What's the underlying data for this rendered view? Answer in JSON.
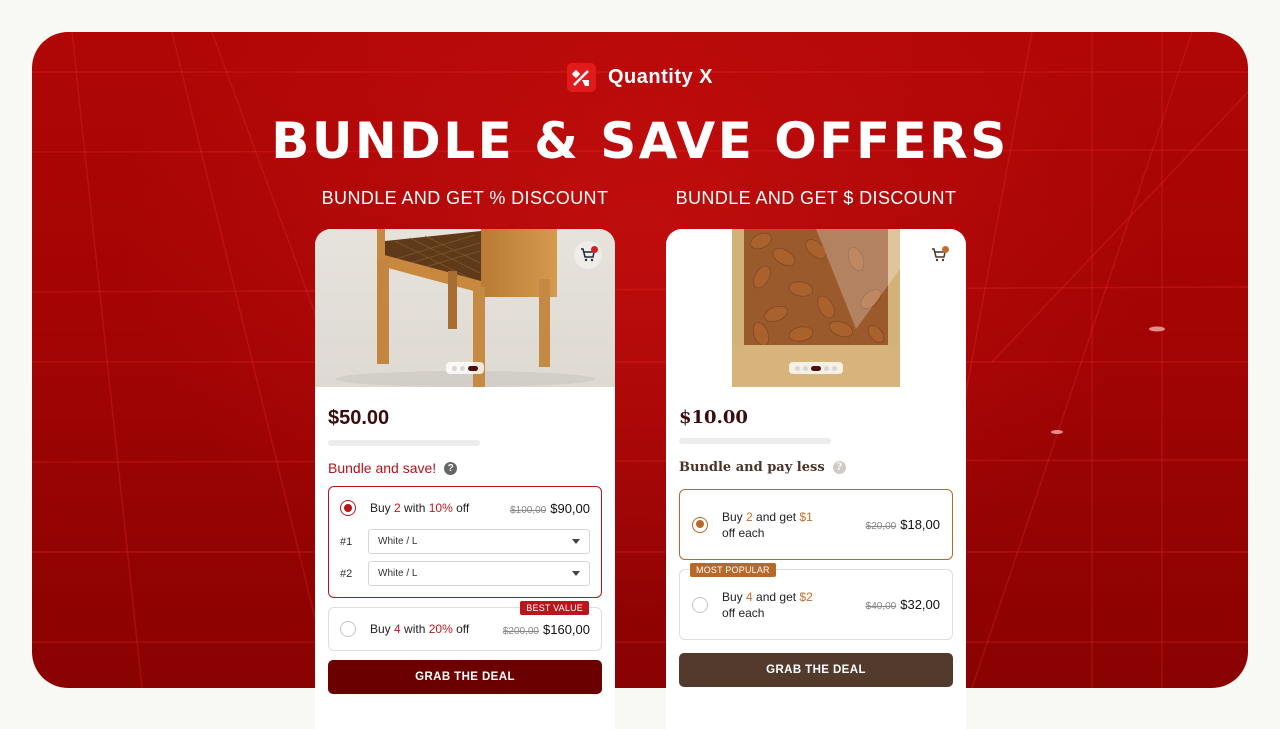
{
  "brand": {
    "name": "Quantity X",
    "logo_icon": "percent-tag-icon",
    "color": "#e11b1b"
  },
  "headline": "BUNDLE & SAVE OFFERS",
  "colors": {
    "banner_red": "#a30404",
    "left_accent": "#b8161c",
    "left_cta": "#6b0000",
    "right_accent": "#b8692a",
    "right_cta": "#523b2d"
  },
  "panels": [
    {
      "subtitle": "BUNDLE AND GET % DISCOUNT",
      "product_image": "wooden-side-table",
      "cart_icon": "cart-icon",
      "carousel": {
        "count": 3,
        "active": 3
      },
      "price": "$50.00",
      "section_title": "Bundle and save!",
      "help_icon": "question-icon",
      "options": [
        {
          "selected": true,
          "text_parts": [
            "Buy ",
            "2",
            " with ",
            "10%",
            " off"
          ],
          "old_price": "$100,00",
          "new_price": "$90,00",
          "variants": [
            {
              "label": "#1",
              "value": "White / L"
            },
            {
              "label": "#2",
              "value": "White / L"
            }
          ]
        },
        {
          "selected": false,
          "badge": "BEST VALUE",
          "text_parts": [
            "Buy ",
            "4",
            " with ",
            "20%",
            " off"
          ],
          "old_price": "$200,00",
          "new_price": "$160,00"
        }
      ],
      "cta": "GRAB THE DEAL"
    },
    {
      "subtitle": "BUNDLE AND GET $ DISCOUNT",
      "product_image": "almonds-bag",
      "cart_icon": "cart-icon",
      "carousel": {
        "count": 5,
        "active": 3
      },
      "price": "$10.00",
      "section_title": "Bundle and pay less",
      "help_icon": "question-icon",
      "options": [
        {
          "selected": true,
          "text_parts": [
            "Buy ",
            "2",
            " and get ",
            "$1",
            " off each"
          ],
          "old_price": "$20,00",
          "new_price": "$18,00"
        },
        {
          "selected": false,
          "badge": "MOST POPULAR",
          "text_parts": [
            "Buy ",
            "4",
            " and get ",
            "$2",
            " off each"
          ],
          "old_price": "$40,00",
          "new_price": "$32,00"
        }
      ],
      "cta": "GRAB THE DEAL"
    }
  ]
}
